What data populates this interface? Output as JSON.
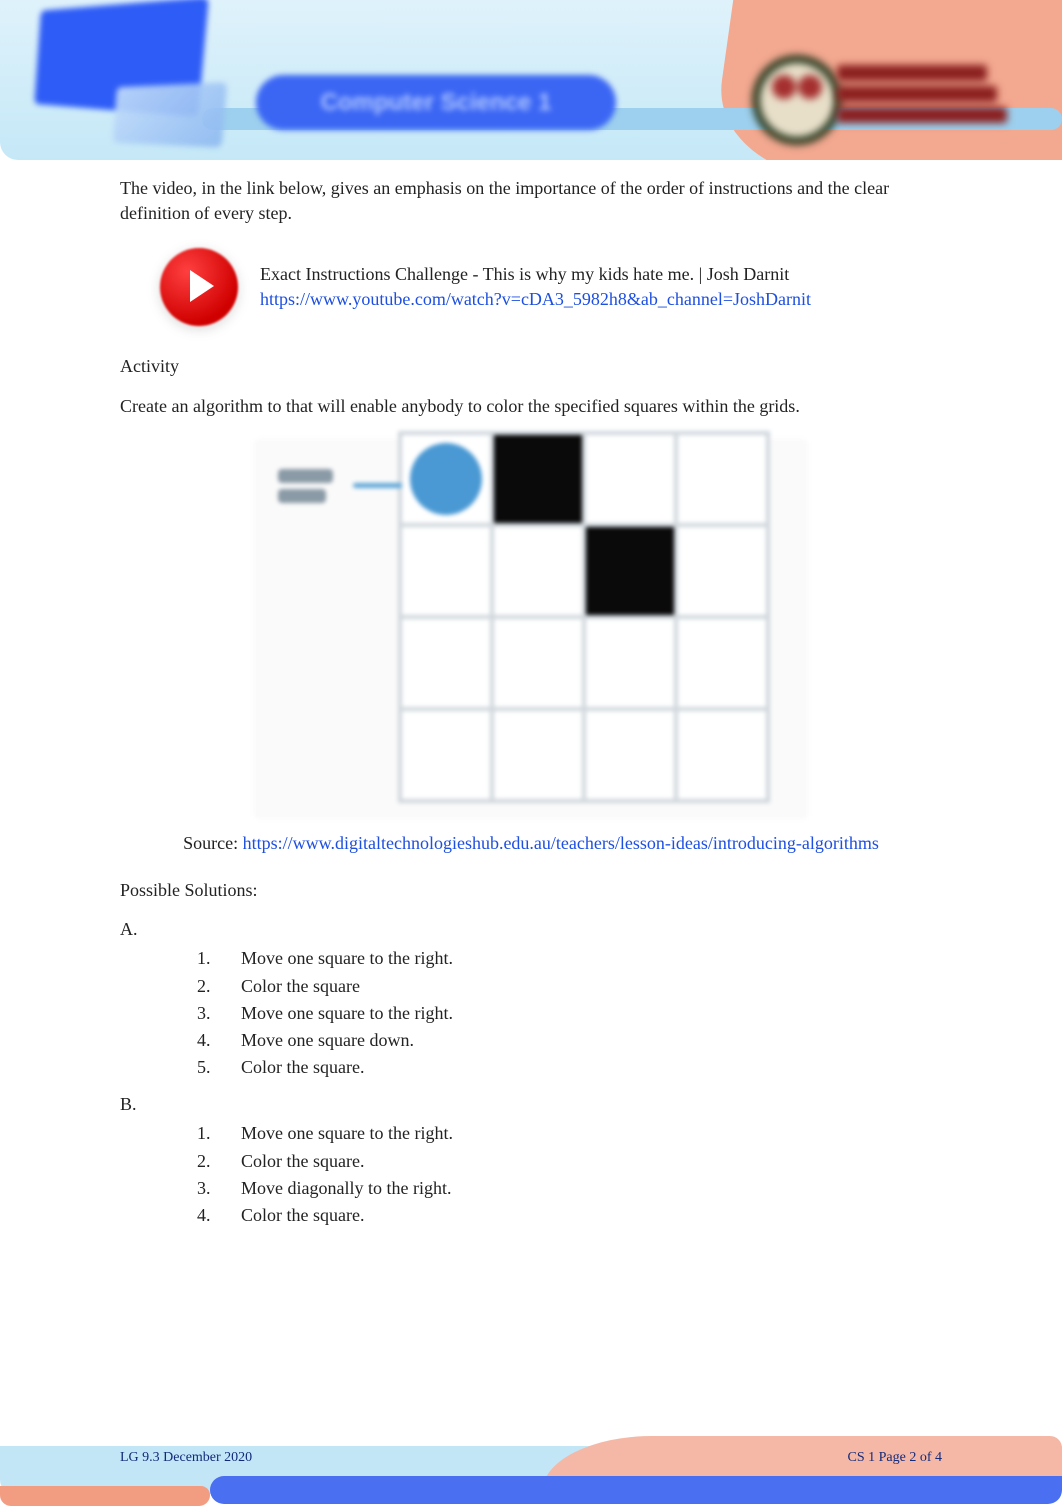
{
  "header": {
    "course_title": "Computer Science 1"
  },
  "body": {
    "intro": "The video, in the link below, gives an emphasis on the importance of the order of instructions and the clear definition of every step.",
    "video": {
      "title": "Exact Instructions Challenge - This is why my kids hate me. | Josh Darnit",
      "url": "https://www.youtube.com/watch?v=cDA3_5982h8&ab_channel=JoshDarnit"
    },
    "activity_heading": "Activity",
    "activity_prompt": "Create an algorithm to that will enable anybody to color the specified squares within the grids.",
    "grid": {
      "label1": "Start",
      "label2": "here",
      "rows": 4,
      "cols": 4,
      "filled": [
        [
          0,
          1
        ],
        [
          1,
          2
        ]
      ],
      "start": [
        0,
        0
      ]
    },
    "source": {
      "label": "Source:",
      "url": "https://www.digitaltechnologieshub.edu.au/teachers/lesson-ideas/introducing-algorithms"
    },
    "solutions_heading": "Possible Solutions:",
    "solutions": {
      "A": [
        "Move one square to the right.",
        "Color the square",
        "Move one square to the right.",
        "Move one square down.",
        "Color the square."
      ],
      "B": [
        "Move one square to the right.",
        "Color the square.",
        "Move diagonally to the right.",
        "Color the square."
      ]
    },
    "list_letters": {
      "A": "A.",
      "B": "B."
    }
  },
  "footer": {
    "left": "LG 9.3 December 2020",
    "right": "CS 1 Page 2 of 4"
  }
}
